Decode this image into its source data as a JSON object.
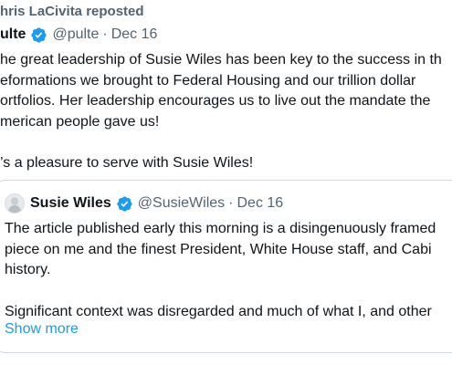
{
  "repost_banner": "hris LaCivita reposted",
  "tweet": {
    "author_name": "ulte",
    "handle": "@pulte",
    "separator": "·",
    "date": "Dec 16",
    "lines": [
      "he great leadership of Susie Wiles has been key to the success in th",
      "eformations we brought to Federal Housing and our trillion dollar",
      "ortfolios. Her leadership encourages us to live out the mandate the",
      "merican people gave us!",
      "",
      "’s a pleasure to serve with Susie Wiles!"
    ]
  },
  "quote": {
    "author_name": "Susie Wiles",
    "handle": "@SusieWiles",
    "separator": "·",
    "date": "Dec 16",
    "lines": [
      "The article published early this morning is a disingenuously framed",
      "piece on me and the finest President, White House staff, and Cabi",
      "history.",
      "",
      "Significant context was disregarded and much of what I, and other"
    ],
    "show_more": "Show more"
  },
  "colors": {
    "verified_blue": "#1d9bf0",
    "link_blue": "#1d9bf0",
    "secondary_text": "#536471"
  },
  "icons": {
    "verified": "verified-badge-icon",
    "avatar": "avatar"
  }
}
